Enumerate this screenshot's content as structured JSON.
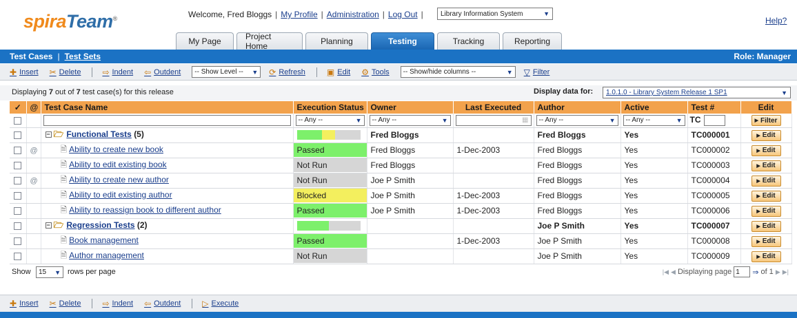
{
  "header": {
    "logo_spira": "spira",
    "logo_team": "Team",
    "logo_reg": "®",
    "welcome": "Welcome, Fred Bloggs",
    "my_profile": "My Profile",
    "administration": "Administration",
    "log_out": "Log Out",
    "project_selected": "Library Information System",
    "help": "Help?"
  },
  "tabs": [
    {
      "label": "My Page"
    },
    {
      "label": "Project Home"
    },
    {
      "label": "Planning"
    },
    {
      "label": "Testing",
      "active": true
    },
    {
      "label": "Tracking"
    },
    {
      "label": "Reporting"
    }
  ],
  "subnav": {
    "test_cases": "Test Cases",
    "test_sets": "Test Sets",
    "role": "Role: Manager"
  },
  "toolbar": {
    "insert": "Insert",
    "delete": "Delete",
    "indent": "Indent",
    "outdent": "Outdent",
    "show_level": "-- Show Level --",
    "refresh": "Refresh",
    "edit": "Edit",
    "tools": "Tools",
    "show_hide_columns": "-- Show/hide columns --",
    "filter": "Filter",
    "execute": "Execute"
  },
  "info": {
    "display_prefix": "Displaying ",
    "display_count": "7",
    "display_middle": " out of ",
    "display_total": "7",
    "display_suffix": " test case(s) for this release",
    "display_for_label": "Display data for:",
    "release_selected": "1.0.1.0 - Library System Release 1 SP1"
  },
  "columns": {
    "check": "✓",
    "attach": "@",
    "name": "Test Case Name",
    "status": "Execution Status",
    "owner": "Owner",
    "last_executed": "Last Executed",
    "author": "Author",
    "active": "Active",
    "test_num": "Test #",
    "edit": "Edit"
  },
  "filters": {
    "status": "-- Any --",
    "owner": "-- Any --",
    "author": "-- Any --",
    "active": "-- Any --",
    "tc_prefix": "TC",
    "filter_button": "Filter"
  },
  "rows": [
    {
      "name": "Functional Tests",
      "count": "(5)",
      "owner": "Fred Bloggs",
      "last_executed": "",
      "author": "Fred Bloggs",
      "active": "Yes",
      "test_num": "TC000001",
      "edit": "Edit"
    },
    {
      "name": "Ability to create new book",
      "status": "Passed",
      "owner": "Fred Bloggs",
      "last_executed": "1-Dec-2003",
      "author": "Fred Bloggs",
      "active": "Yes",
      "test_num": "TC000002",
      "edit": "Edit"
    },
    {
      "name": "Ability to edit existing book",
      "status": "Not Run",
      "owner": "Fred Bloggs",
      "last_executed": "",
      "author": "Fred Bloggs",
      "active": "Yes",
      "test_num": "TC000003",
      "edit": "Edit"
    },
    {
      "name": "Ability to create new author",
      "status": "Not Run",
      "owner": "Joe P Smith",
      "last_executed": "",
      "author": "Fred Bloggs",
      "active": "Yes",
      "test_num": "TC000004",
      "edit": "Edit"
    },
    {
      "name": "Ability to edit existing author",
      "status": "Blocked",
      "owner": "Joe P Smith",
      "last_executed": "1-Dec-2003",
      "author": "Fred Bloggs",
      "active": "Yes",
      "test_num": "TC000005",
      "edit": "Edit"
    },
    {
      "name": "Ability to reassign book to different author",
      "status": "Passed",
      "owner": "Joe P Smith",
      "last_executed": "1-Dec-2003",
      "author": "Fred Bloggs",
      "active": "Yes",
      "test_num": "TC000006",
      "edit": "Edit"
    },
    {
      "name": "Regression Tests",
      "count": "(2)",
      "owner": "",
      "last_executed": "",
      "author": "Joe P Smith",
      "active": "Yes",
      "test_num": "TC000007",
      "edit": "Edit"
    },
    {
      "name": "Book management",
      "status": "Passed",
      "owner": "",
      "last_executed": "1-Dec-2003",
      "author": "Joe P Smith",
      "active": "Yes",
      "test_num": "TC000008",
      "edit": "Edit"
    },
    {
      "name": "Author management",
      "status": "Not Run",
      "owner": "",
      "last_executed": "",
      "author": "Joe P Smith",
      "active": "Yes",
      "test_num": "TC000009",
      "edit": "Edit"
    }
  ],
  "folder_progress": {
    "functional": {
      "passed": 0.4,
      "blocked": 0.2
    },
    "regression": {
      "passed": 0.5,
      "blocked": 0
    }
  },
  "status_colors": {
    "Passed": "#7df06b",
    "Blocked": "#f3ef5e",
    "Not Run": "#d6d6d6"
  },
  "pager": {
    "show": "Show",
    "rows_per_page": "15",
    "rows_label": "rows per page",
    "displaying_page": "Displaying page",
    "page": "1",
    "of_pages": "of 1"
  }
}
